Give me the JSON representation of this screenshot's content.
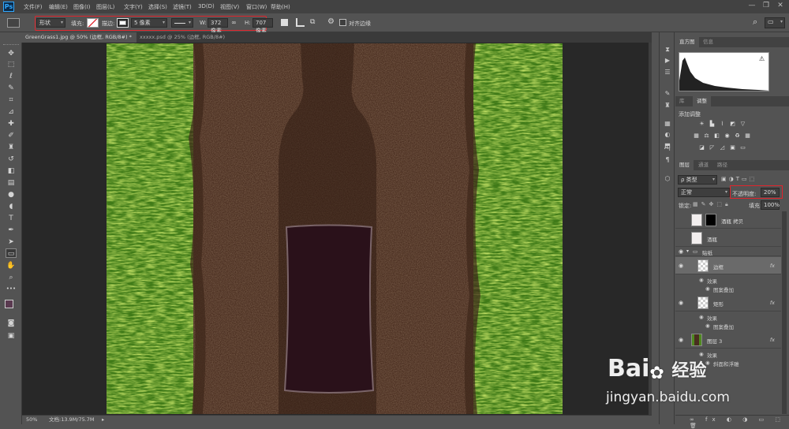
{
  "app": {
    "logo": "Ps"
  },
  "menubar": {
    "items": [
      "文件(F)",
      "编辑(E)",
      "图像(I)",
      "图层(L)",
      "文字(Y)",
      "选择(S)",
      "滤镜(T)",
      "3D(D)",
      "视图(V)",
      "窗口(W)",
      "帮助(H)"
    ],
    "window_controls": [
      "minimize-icon",
      "restore-icon",
      "close-icon"
    ]
  },
  "options_bar": {
    "mode_value": "形状",
    "fill_label": "填充:",
    "stroke_label": "描边:",
    "stroke_width_value": "5 像素",
    "w_label": "W:",
    "w_value": "372 像素",
    "h_label": "H:",
    "h_value": "707 像素",
    "align_edges_label": "对齐边缘",
    "accent_color": "#e0242c"
  },
  "tabs": [
    {
      "label": "GreenGrass1.jpg @ 50% (边框, RGB/8#) *",
      "close": "×",
      "active": true
    },
    {
      "label": "xxxxx.psd @ 25% (边框, RGB/8#) *",
      "close": "×",
      "active": false
    }
  ],
  "status": {
    "zoom": "50%",
    "doc": "文档:13.9M/75.7M",
    "arrow": "▸"
  },
  "histogram_panel": {
    "tabs": [
      "直方图",
      "信息"
    ],
    "warning": "⚠"
  },
  "adjust_panel": {
    "tabs": [
      "库",
      "调整"
    ],
    "title": "添加调整"
  },
  "layers_panel": {
    "tabs": [
      "图层",
      "通道",
      "路径"
    ],
    "filter_kind": "ρ 类型",
    "blend_mode": "正常",
    "opacity_label": "不透明度:",
    "opacity_value": "20%",
    "lock_label": "锁定:",
    "fill_label": "填充:",
    "fill_value": "100%",
    "layers": [
      {
        "name": "酒瓶 拷贝",
        "visible": false,
        "fx": ""
      },
      {
        "name": "酒瓶",
        "visible": false,
        "fx": ""
      },
      {
        "name": "贴纸",
        "visible": true,
        "fx": "",
        "group": true
      },
      {
        "name": "边框",
        "visible": true,
        "fx": "fx",
        "selected": true
      },
      {
        "name": "效果",
        "visible": true,
        "sub": true
      },
      {
        "name": "图案叠加",
        "visible": true,
        "sub": true
      },
      {
        "name": "矩形",
        "visible": true,
        "fx": "fx"
      },
      {
        "name": "效果",
        "visible": true,
        "sub": true
      },
      {
        "name": "图案叠加",
        "visible": true,
        "sub": true
      },
      {
        "name": "图层 3",
        "visible": true,
        "fx": "fx"
      },
      {
        "name": "效果",
        "visible": true,
        "sub": true
      },
      {
        "name": "斜面和浮雕",
        "visible": true,
        "sub": true
      }
    ],
    "footer_icons": [
      "link-icon",
      "fx-icon",
      "mask-icon",
      "adjustment-icon",
      "folder-icon",
      "new-layer-icon",
      "trash-icon"
    ]
  },
  "watermark": {
    "brand": "Bai",
    "brand2": "经验",
    "url": "jingyan.baidu.com"
  },
  "colors": {
    "soil": "#4a2e20",
    "grass": "#4f8a1f",
    "label": "#2a111a"
  }
}
